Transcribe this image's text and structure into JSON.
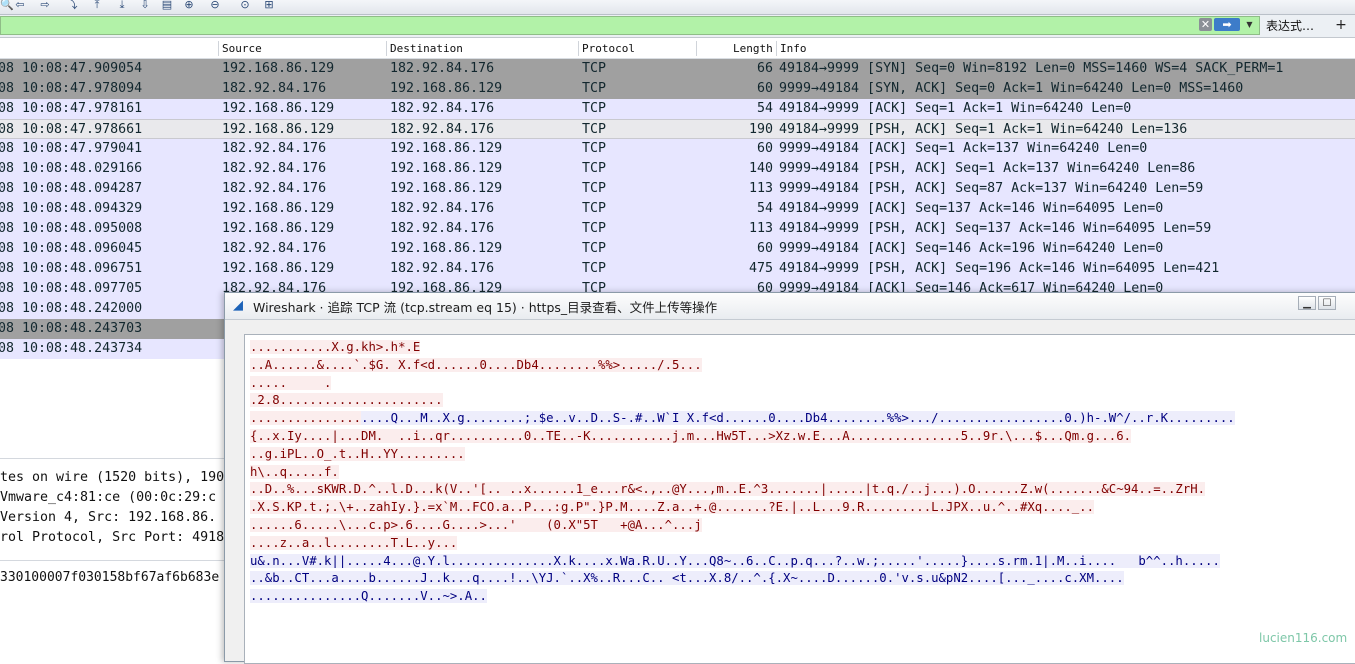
{
  "toolbar": {
    "icons": [
      "search-icon",
      "arrow-left-icon",
      "arrow-right-icon",
      "go-to-icon",
      "go-first-icon",
      "go-last-icon",
      "autoscroll-icon",
      "colorize-icon",
      "zoom-in-icon",
      "zoom-out-icon",
      "zoom-reset-icon",
      "resize-columns-icon"
    ]
  },
  "filter": {
    "value": "",
    "clear_label": "✕",
    "apply_label": "➡",
    "dropdown_label": "▼",
    "expression_label": "表达式…",
    "add_label": "+"
  },
  "columns": {
    "source": "Source",
    "destination": "Destination",
    "protocol": "Protocol",
    "length": "Length",
    "info": "Info"
  },
  "packets": [
    {
      "time": "08 10:08:47.909054",
      "src": "192.168.86.129",
      "dst": "182.92.84.176",
      "proto": "TCP",
      "len": "66",
      "info": "49184→9999 [SYN] Seq=0 Win=8192 Len=0 MSS=1460 WS=4 SACK_PERM=1",
      "style": "gray"
    },
    {
      "time": "08 10:08:47.978094",
      "src": "182.92.84.176",
      "dst": "192.168.86.129",
      "proto": "TCP",
      "len": "60",
      "info": "9999→49184 [SYN, ACK] Seq=0 Ack=1 Win=64240 Len=0 MSS=1460",
      "style": "gray"
    },
    {
      "time": "08 10:08:47.978161",
      "src": "192.168.86.129",
      "dst": "182.92.84.176",
      "proto": "TCP",
      "len": "54",
      "info": "49184→9999 [ACK] Seq=1 Ack=1 Win=64240 Len=0",
      "style": "lav"
    },
    {
      "time": "08 10:08:47.978661",
      "src": "192.168.86.129",
      "dst": "182.92.84.176",
      "proto": "TCP",
      "len": "190",
      "info": "49184→9999 [PSH, ACK] Seq=1 Ack=1 Win=64240 Len=136",
      "style": "sel"
    },
    {
      "time": "08 10:08:47.979041",
      "src": "182.92.84.176",
      "dst": "192.168.86.129",
      "proto": "TCP",
      "len": "60",
      "info": "9999→49184 [ACK] Seq=1 Ack=137 Win=64240 Len=0",
      "style": "lav"
    },
    {
      "time": "08 10:08:48.029166",
      "src": "182.92.84.176",
      "dst": "192.168.86.129",
      "proto": "TCP",
      "len": "140",
      "info": "9999→49184 [PSH, ACK] Seq=1 Ack=137 Win=64240 Len=86",
      "style": "lav"
    },
    {
      "time": "08 10:08:48.094287",
      "src": "182.92.84.176",
      "dst": "192.168.86.129",
      "proto": "TCP",
      "len": "113",
      "info": "9999→49184 [PSH, ACK] Seq=87 Ack=137 Win=64240 Len=59",
      "style": "lav"
    },
    {
      "time": "08 10:08:48.094329",
      "src": "192.168.86.129",
      "dst": "182.92.84.176",
      "proto": "TCP",
      "len": "54",
      "info": "49184→9999 [ACK] Seq=137 Ack=146 Win=64095 Len=0",
      "style": "lav"
    },
    {
      "time": "08 10:08:48.095008",
      "src": "192.168.86.129",
      "dst": "182.92.84.176",
      "proto": "TCP",
      "len": "113",
      "info": "49184→9999 [PSH, ACK] Seq=137 Ack=146 Win=64095 Len=59",
      "style": "lav"
    },
    {
      "time": "08 10:08:48.096045",
      "src": "182.92.84.176",
      "dst": "192.168.86.129",
      "proto": "TCP",
      "len": "60",
      "info": "9999→49184 [ACK] Seq=146 Ack=196 Win=64240 Len=0",
      "style": "lav"
    },
    {
      "time": "08 10:08:48.096751",
      "src": "192.168.86.129",
      "dst": "182.92.84.176",
      "proto": "TCP",
      "len": "475",
      "info": "49184→9999 [PSH, ACK] Seq=196 Ack=146 Win=64095 Len=421",
      "style": "lav"
    },
    {
      "time": "08 10:08:48.097705",
      "src": "182.92.84.176",
      "dst": "192.168.86.129",
      "proto": "TCP",
      "len": "60",
      "info": "9999→49184 [ACK] Seq=146 Ack=617 Win=64240 Len=0",
      "style": "lav"
    },
    {
      "time": "08 10:08:48.242000",
      "src": "",
      "dst": "",
      "proto": "",
      "len": "",
      "info": "",
      "style": "lav"
    },
    {
      "time": "08 10:08:48.243703",
      "src": "",
      "dst": "",
      "proto": "",
      "len": "",
      "info": "",
      "style": "gray"
    },
    {
      "time": "08 10:08:48.243734",
      "src": "",
      "dst": "",
      "proto": "",
      "len": "",
      "info": "",
      "style": "lav"
    }
  ],
  "details": [
    "tes on wire (1520 bits), 190",
    " Vmware_c4:81:ce (00:0c:29:c",
    " Version 4, Src: 192.168.86.",
    "rol Protocol, Src Port: 4918"
  ],
  "hex": "330100007f030158bf67af6b683e",
  "dialog": {
    "title": "Wireshark · 追踪 TCP 流 (tcp.stream eq 15) · https_目录查看、文件上传等操作",
    "minimize_label": "▁",
    "maximize_label": "☐"
  },
  "stream_lines": [
    [
      {
        "t": "...........X.g.kh>.h*.E",
        "s": "cl"
      }
    ],
    [
      {
        "t": "..A......&....`.$G. X.f<d......0....Db4........%%>...../.5...",
        "s": "cl"
      }
    ],
    [
      {
        "t": ".....     .",
        "s": "cl"
      }
    ],
    [
      {
        "t": ".2.8......................",
        "s": "cl"
      }
    ],
    [
      {
        "t": "...............",
        "s": "cl"
      },
      {
        "t": "....Q...M..X.g........;.$e..v..D..S-.#..W`I X.f<d......0....Db4........%%>.../.................0.)h-.W^/..r.K.........",
        "s": "sv"
      }
    ],
    [
      {
        "t": "{..x.Iy....|...DM.  ..i..qr..........0..TE..-K...........j.m...Hw5T...>Xz.w.E...A...............5..9r.\\...$...Qm.g...6.",
        "s": "cl"
      }
    ],
    [
      {
        "t": "..g.iPL..O_.t..H..YY.........",
        "s": "cl"
      }
    ],
    [
      {
        "t": "h\\..q.....f.",
        "s": "cl"
      }
    ],
    [
      {
        "t": "..D..%...sKWR.D.^..l.D...k(V..'[.. ..x......1_e...r&<.,..@Y...,m..E.^3.......|.....|t.q./..j...).O......Z.w(.......&C~94..=..ZrH.",
        "s": "cl"
      }
    ],
    [
      {
        "t": ".X.S.KP.t.;.\\+..zahIy.}.=x`M..FCO.a..P...:g.P\".}P.M....Z.a..+.@.......?E.|..L...9.R.........L.JPX..u.^..#Xq...._..",
        "s": "cl"
      }
    ],
    [
      {
        "t": "......6.....\\...c.p>.6....G....>...'    (0.X\"5T   +@A...^...j",
        "s": "cl"
      }
    ],
    [
      {
        "t": "....z..a..l........T.L..y...",
        "s": "cl"
      }
    ],
    [
      {
        "t": "u&.n...V#.k||",
        "s": "sv"
      },
      {
        "t": ".....4...@.Y.l..............X.k....x.Wa.R.U..Y...Q8~..6..C..p.q...?..w.;.....'.....}....s.rm.1|.M..i....   b^^..h.....",
        "s": "sv"
      }
    ],
    [
      {
        "t": "..&b..CT...a....b......J..k...q....!..\\YJ.`..X%..R...C.. <t...X.8/..^.{.X~....D......0.'v.s.u&pN2....[..._....c.XM....",
        "s": "sv"
      }
    ],
    [
      {
        "t": "...............Q.......V..~>.A..",
        "s": "sv"
      }
    ]
  ],
  "watermark": "lucien116.com",
  "colors": {
    "filter_bg": "#b2f2a8",
    "row_gray": "#a0a0a0",
    "row_lavender": "#e7e6ff",
    "client_text": "#800000",
    "client_bg": "#fbeded",
    "server_text": "#000080",
    "server_bg": "#ededfb"
  }
}
